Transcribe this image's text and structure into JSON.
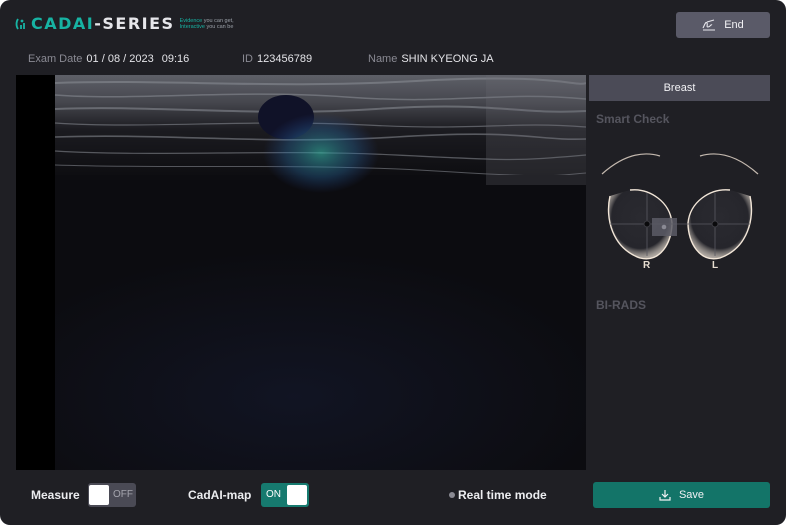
{
  "brand": {
    "logo_text_main": "CADAI",
    "logo_text_suffix": "-SERIES",
    "tagline_line1_accent": "Evidence",
    "tagline_line1": " you can get,",
    "tagline_line2_accent": "Interactive",
    "tagline_line2": " you can be",
    "accent_color": "#17b3a3"
  },
  "header": {
    "end_label": "End",
    "end_icon": "exit-signature-icon"
  },
  "exam": {
    "date_label": "Exam Date",
    "date_value": "01 / 08 / 2023",
    "time_value": "09:16",
    "id_label": "ID",
    "id_value": "123456789",
    "name_label": "Name",
    "name_value": "SHIN KYEONG JA"
  },
  "side_panel": {
    "tab_label": "Breast",
    "smart_check_label": "Smart Check",
    "right_marker": "R",
    "left_marker": "L",
    "birads_label": "BI-RADS"
  },
  "controls": {
    "measure_label": "Measure",
    "measure_state": "OFF",
    "cadai_map_label": "CadAI-map",
    "cadai_map_state": "ON",
    "realtime_label": "Real time mode",
    "save_label": "Save",
    "save_icon": "download-icon",
    "on_color": "#167a6f",
    "save_color": "#137468"
  }
}
